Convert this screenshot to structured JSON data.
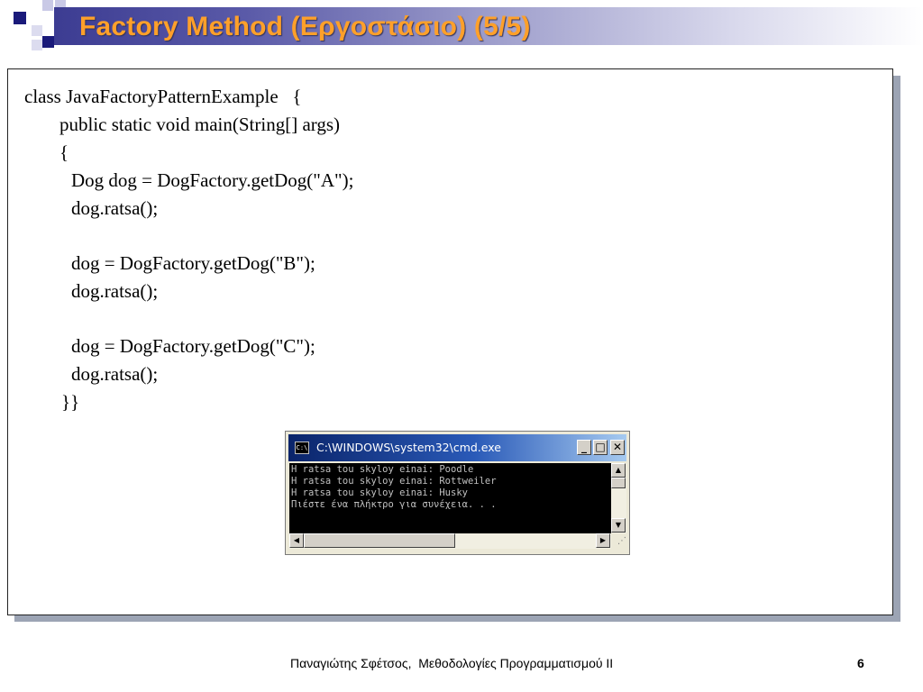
{
  "slide": {
    "title": "Factory Method (Εργοστάσιο) (5/5)",
    "colors": {
      "title": "#ffa02a",
      "accent": "#1a1a7a"
    },
    "code_lines": [
      "class JavaFactoryPatternExample   {",
      "public static void main(String[] args)",
      "{",
      "Dog dog = DogFactory.getDog(\"A\");",
      "dog.ratsa();",
      "dog = DogFactory.getDog(\"B\");",
      "dog.ratsa();",
      "dog = DogFactory.getDog(\"C\");",
      "dog.ratsa();",
      "}}"
    ]
  },
  "cmd": {
    "icon": "cmd-icon",
    "icon_text": "C:\\",
    "title": "C:\\WINDOWS\\system32\\cmd.exe",
    "buttons": {
      "minimize": "_",
      "maximize": "□",
      "close": "✕"
    },
    "output_lines": [
      "H ratsa tou skyloy einai: Poodle",
      "H ratsa tou skyloy einai: Rottweiler",
      "H ratsa tou skyloy einai: Husky",
      "Πιέστε ένα πλήκτρο για συνέχεια. . ."
    ]
  },
  "footer": {
    "author": "Παναγιώτης Σφέτσος,  Μεθοδολογίες Προγραμματισμού ΙΙ",
    "page": "6"
  }
}
